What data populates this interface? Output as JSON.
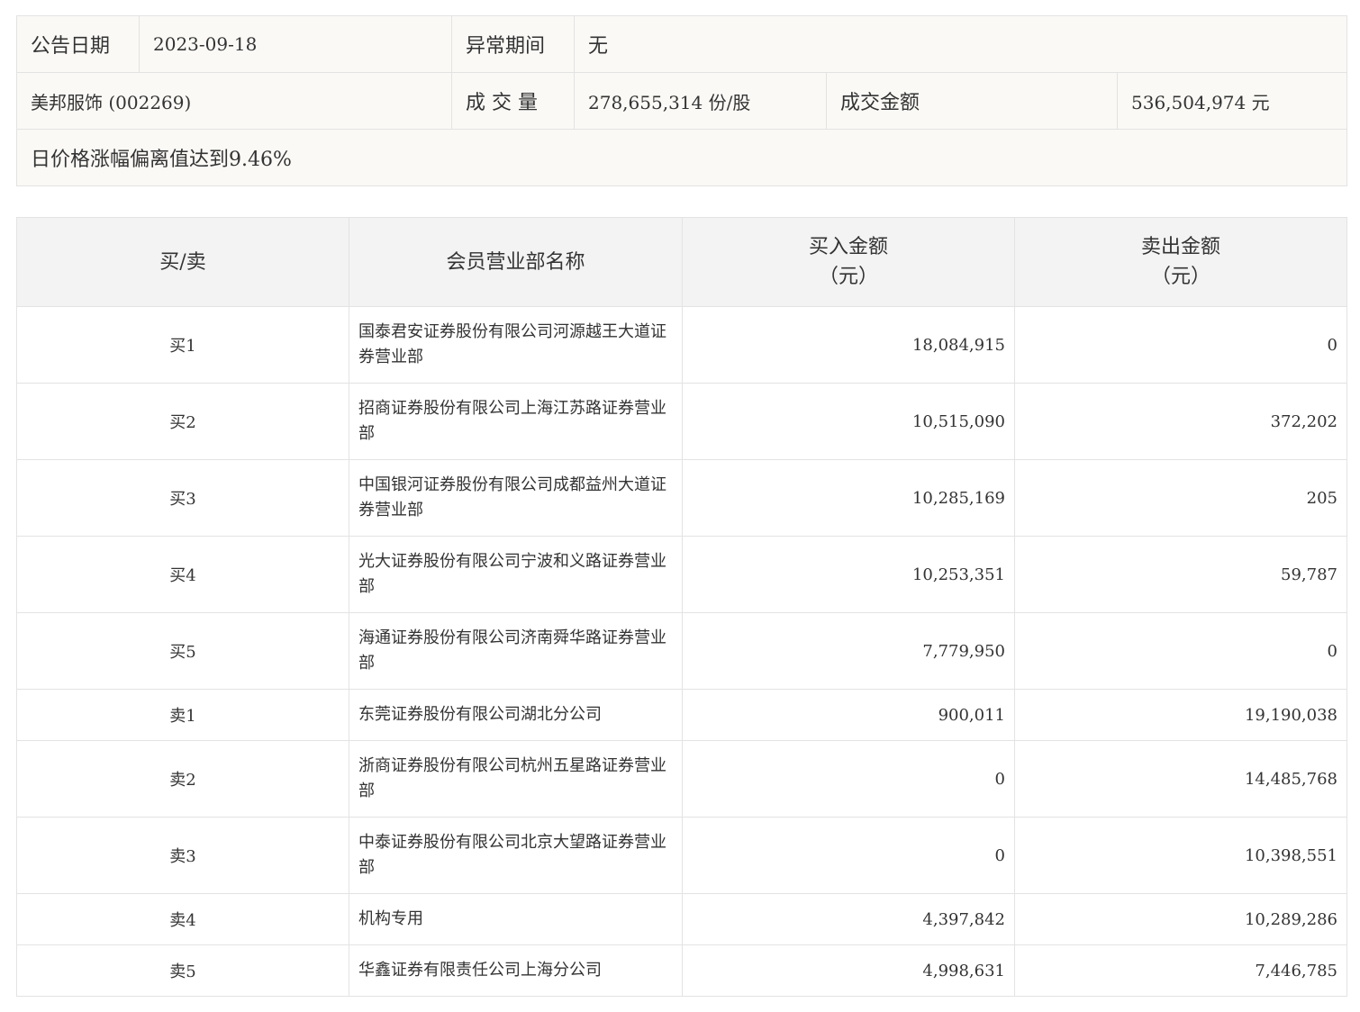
{
  "info": {
    "announce_date_label": "公告日期",
    "announce_date": "2023-09-18",
    "abnormal_period_label": "异常期间",
    "abnormal_period": "无",
    "stock": "美邦服饰 (002269)",
    "volume_label": "成 交 量",
    "volume": "278,655,314 份/股",
    "turnover_label": "成交金额",
    "turnover": "536,504,974 元",
    "reason": "日价格涨幅偏离值达到9.46%"
  },
  "trade": {
    "headers": {
      "side": "买/卖",
      "member": "会员营业部名称",
      "buy": "买入金额",
      "buy_unit": "（元）",
      "sell": "卖出金额",
      "sell_unit": "（元）"
    },
    "rows": [
      {
        "side": "买1",
        "name": "国泰君安证券股份有限公司河源越王大道证券营业部",
        "buy": "18,084,915",
        "sell": "0"
      },
      {
        "side": "买2",
        "name": "招商证券股份有限公司上海江苏路证券营业部",
        "buy": "10,515,090",
        "sell": "372,202"
      },
      {
        "side": "买3",
        "name": "中国银河证券股份有限公司成都益州大道证券营业部",
        "buy": "10,285,169",
        "sell": "205"
      },
      {
        "side": "买4",
        "name": "光大证券股份有限公司宁波和义路证券营业部",
        "buy": "10,253,351",
        "sell": "59,787"
      },
      {
        "side": "买5",
        "name": "海通证券股份有限公司济南舜华路证券营业部",
        "buy": "7,779,950",
        "sell": "0"
      },
      {
        "side": "卖1",
        "name": "东莞证券股份有限公司湖北分公司",
        "buy": "900,011",
        "sell": "19,190,038"
      },
      {
        "side": "卖2",
        "name": "浙商证券股份有限公司杭州五星路证券营业部",
        "buy": "0",
        "sell": "14,485,768"
      },
      {
        "side": "卖3",
        "name": "中泰证券股份有限公司北京大望路证券营业部",
        "buy": "0",
        "sell": "10,398,551"
      },
      {
        "side": "卖4",
        "name": "机构专用",
        "buy": "4,397,842",
        "sell": "10,289,286"
      },
      {
        "side": "卖5",
        "name": "华鑫证券有限责任公司上海分公司",
        "buy": "4,998,631",
        "sell": "7,446,785"
      }
    ]
  }
}
